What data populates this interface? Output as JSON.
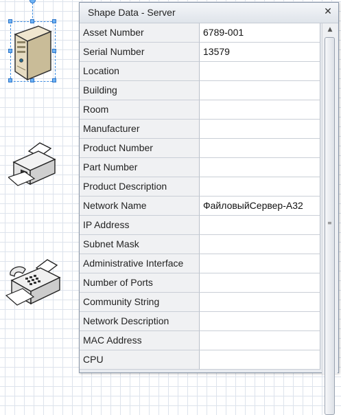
{
  "panel": {
    "title": "Shape Data - Server",
    "close_glyph": "✕"
  },
  "fields": [
    {
      "label": "Asset Number",
      "value": "6789-001"
    },
    {
      "label": "Serial Number",
      "value": "13579"
    },
    {
      "label": "Location",
      "value": ""
    },
    {
      "label": "Building",
      "value": ""
    },
    {
      "label": "Room",
      "value": ""
    },
    {
      "label": "Manufacturer",
      "value": ""
    },
    {
      "label": "Product Number",
      "value": ""
    },
    {
      "label": "Part Number",
      "value": ""
    },
    {
      "label": "Product Description",
      "value": ""
    },
    {
      "label": "Network Name",
      "value": "ФайловыйСервер-А32"
    },
    {
      "label": "IP Address",
      "value": ""
    },
    {
      "label": "Subnet Mask",
      "value": ""
    },
    {
      "label": "Administrative Interface",
      "value": ""
    },
    {
      "label": "Number of Ports",
      "value": ""
    },
    {
      "label": "Community String",
      "value": ""
    },
    {
      "label": "Network Description",
      "value": ""
    },
    {
      "label": "MAC Address",
      "value": ""
    },
    {
      "label": "CPU",
      "value": ""
    }
  ],
  "scroll": {
    "up_arrow": "▲",
    "grip": "≡"
  },
  "shapes": [
    {
      "name": "server",
      "icon": "server-icon",
      "selected": true
    },
    {
      "name": "printer",
      "icon": "printer-icon",
      "selected": false
    },
    {
      "name": "fax",
      "icon": "fax-icon",
      "selected": false
    }
  ]
}
